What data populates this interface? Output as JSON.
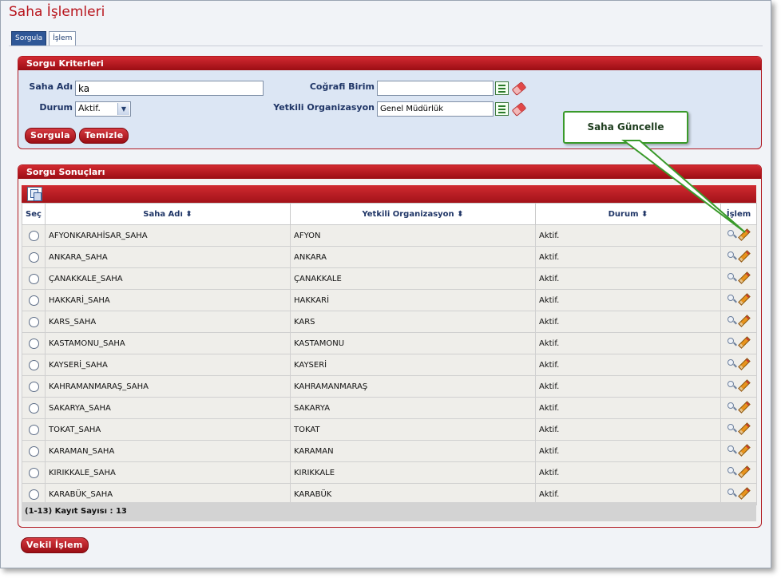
{
  "page": {
    "title": "Saha İşlemleri"
  },
  "tabs": [
    {
      "label": "Sorgula",
      "active": true
    },
    {
      "label": "İşlem",
      "active": false
    }
  ],
  "criteria": {
    "header": "Sorgu Kriterleri",
    "saha_adi": {
      "label": "Saha Adı",
      "value": "ka"
    },
    "durum": {
      "label": "Durum",
      "value": "Aktif."
    },
    "cografi_birim": {
      "label": "Coğrafi Birim",
      "value": ""
    },
    "yetkili_org": {
      "label": "Yetkili Organizasyon",
      "value": "Genel Müdürlük"
    },
    "buttons": {
      "query": "Sorgula",
      "clear": "Temizle"
    }
  },
  "callout": {
    "text": "Saha Güncelle"
  },
  "results": {
    "header": "Sorgu Sonuçları",
    "columns": {
      "select": "Seç",
      "saha_adi": "Saha Adı ⬍",
      "org": "Yetkili Organizasyon ⬍",
      "durum": "Durum ⬍",
      "islem": "İşlem"
    },
    "rows": [
      {
        "saha_adi": "AFYONKARAHİSAR_SAHA",
        "org": "AFYON",
        "durum": "Aktif."
      },
      {
        "saha_adi": "ANKARA_SAHA",
        "org": "ANKARA",
        "durum": "Aktif."
      },
      {
        "saha_adi": "ÇANAKKALE_SAHA",
        "org": "ÇANAKKALE",
        "durum": "Aktif."
      },
      {
        "saha_adi": "HAKKARİ_SAHA",
        "org": "HAKKARİ",
        "durum": "Aktif."
      },
      {
        "saha_adi": "KARS_SAHA",
        "org": "KARS",
        "durum": "Aktif."
      },
      {
        "saha_adi": "KASTAMONU_SAHA",
        "org": "KASTAMONU",
        "durum": "Aktif."
      },
      {
        "saha_adi": "KAYSERİ_SAHA",
        "org": "KAYSERİ",
        "durum": "Aktif."
      },
      {
        "saha_adi": "KAHRAMANMARAŞ_SAHA",
        "org": "KAHRAMANMARAŞ",
        "durum": "Aktif."
      },
      {
        "saha_adi": "SAKARYA_SAHA",
        "org": "SAKARYA",
        "durum": "Aktif."
      },
      {
        "saha_adi": "TOKAT_SAHA",
        "org": "TOKAT",
        "durum": "Aktif."
      },
      {
        "saha_adi": "KARAMAN_SAHA",
        "org": "KARAMAN",
        "durum": "Aktif."
      },
      {
        "saha_adi": "KIRIKKALE_SAHA",
        "org": "KIRIKKALE",
        "durum": "Aktif."
      },
      {
        "saha_adi": "KARABÜK_SAHA",
        "org": "KARABÜK",
        "durum": "Aktif."
      }
    ],
    "footer": "(1-13) Kayıt Sayısı : 13"
  },
  "proxy_button": "Vekil İşlem",
  "colors": {
    "accent": "#b8141c",
    "panel_bg": "#dce6f4",
    "callout_border": "#3a9a2a"
  }
}
